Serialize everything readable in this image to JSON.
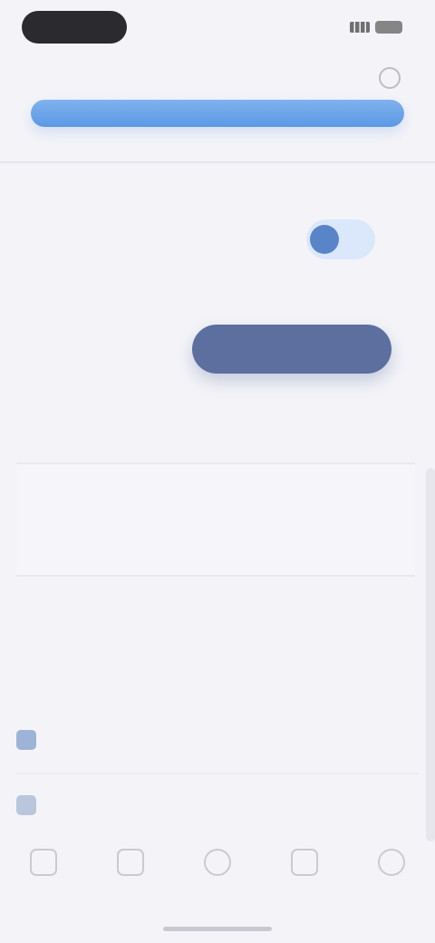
{
  "status": {
    "time": ""
  },
  "header": {
    "title": "",
    "progress": 1.0,
    "accent": "#5b98e4"
  },
  "card": {
    "title": "",
    "subtitle": "",
    "description": "",
    "toggle_on": true
  },
  "actions": {
    "secondary_label": "",
    "primary_label": ""
  },
  "notes": {
    "label": "",
    "placeholder": ""
  },
  "list": {
    "label": "",
    "items": [
      {
        "label": "",
        "value": "",
        "icon": "document-icon"
      },
      {
        "label": "",
        "value": "",
        "icon": "pencil-icon"
      }
    ]
  },
  "nav": {
    "items": [
      {
        "label": "",
        "icon": "home-icon"
      },
      {
        "label": "",
        "icon": "grid-icon"
      },
      {
        "label": "",
        "icon": "plus-icon"
      },
      {
        "label": "",
        "icon": "chart-icon"
      },
      {
        "label": "",
        "icon": "profile-icon"
      }
    ]
  }
}
